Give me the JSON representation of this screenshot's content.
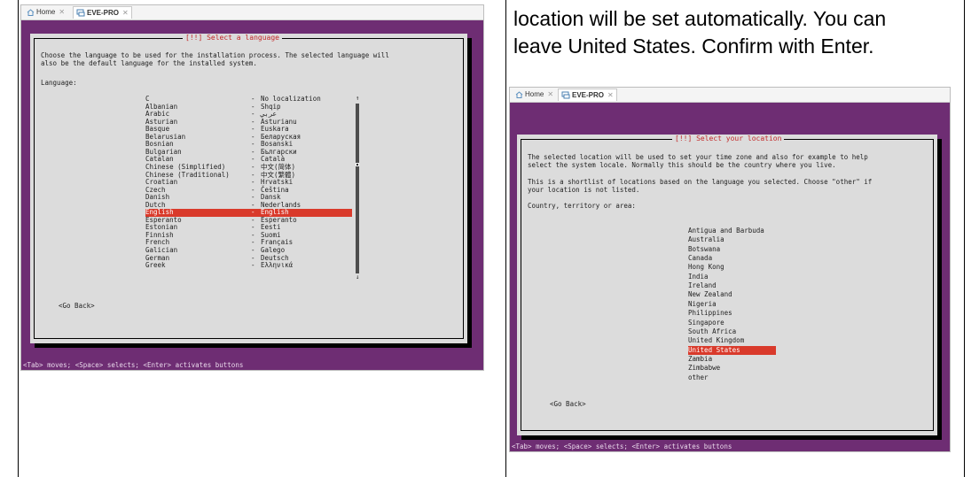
{
  "caption": {
    "line1": "location will be set automatically. You can",
    "line2": "leave United States. Confirm with Enter."
  },
  "screenshot1": {
    "tabs": {
      "home": "Home",
      "vm": "EVE-PRO"
    },
    "dialog_title": "[!!] Select a language",
    "description_line1": "Choose the language to be used for the installation process. The selected language will",
    "description_line2": "also be the default language for the installed system.",
    "list_label": "Language:",
    "languages": [
      {
        "name": "C",
        "native": "No localization"
      },
      {
        "name": "Albanian",
        "native": "Shqip"
      },
      {
        "name": "Arabic",
        "native": "عربي"
      },
      {
        "name": "Asturian",
        "native": "Asturianu"
      },
      {
        "name": "Basque",
        "native": "Euskara"
      },
      {
        "name": "Belarusian",
        "native": "Беларуская"
      },
      {
        "name": "Bosnian",
        "native": "Bosanski"
      },
      {
        "name": "Bulgarian",
        "native": "Български"
      },
      {
        "name": "Catalan",
        "native": "Català"
      },
      {
        "name": "Chinese (Simplified)",
        "native": "中文(简体)"
      },
      {
        "name": "Chinese (Traditional)",
        "native": "中文(繁體)"
      },
      {
        "name": "Croatian",
        "native": "Hrvatski"
      },
      {
        "name": "Czech",
        "native": "Čeština"
      },
      {
        "name": "Danish",
        "native": "Dansk"
      },
      {
        "name": "Dutch",
        "native": "Nederlands"
      },
      {
        "name": "English",
        "native": "English"
      },
      {
        "name": "Esperanto",
        "native": "Esperanto"
      },
      {
        "name": "Estonian",
        "native": "Eesti"
      },
      {
        "name": "Finnish",
        "native": "Suomi"
      },
      {
        "name": "French",
        "native": "Français"
      },
      {
        "name": "Galician",
        "native": "Galego"
      },
      {
        "name": "German",
        "native": "Deutsch"
      },
      {
        "name": "Greek",
        "native": "Ελληνικά"
      }
    ],
    "selected_language": "English",
    "go_back": "<Go Back>",
    "status": "<Tab> moves; <Space> selects; <Enter> activates buttons"
  },
  "screenshot2": {
    "tabs": {
      "home": "Home",
      "vm": "EVE-PRO"
    },
    "dialog_title": "[!!] Select your location",
    "description_line1": "The selected location will be used to set your time zone and also for example to help",
    "description_line2": "select the system locale. Normally this should be the country where you live.",
    "description_line3": "This is a shortlist of locations based on the language you selected. Choose \"other\" if",
    "description_line4": "your location is not listed.",
    "list_label": "Country, territory or area:",
    "locations": [
      "Antigua and Barbuda",
      "Australia",
      "Botswana",
      "Canada",
      "Hong Kong",
      "India",
      "Ireland",
      "New Zealand",
      "Nigeria",
      "Philippines",
      "Singapore",
      "South Africa",
      "United Kingdom",
      "United States",
      "Zambia",
      "Zimbabwe",
      "other"
    ],
    "selected_location": "United States",
    "go_back": "<Go Back>",
    "status": "<Tab> moves; <Space> selects; <Enter> activates buttons"
  },
  "colors": {
    "terminal_bg": "#6e2d73",
    "dialog_bg": "#dcdcdc",
    "highlight": "#d93a2b",
    "title_red": "#c32a2a"
  }
}
